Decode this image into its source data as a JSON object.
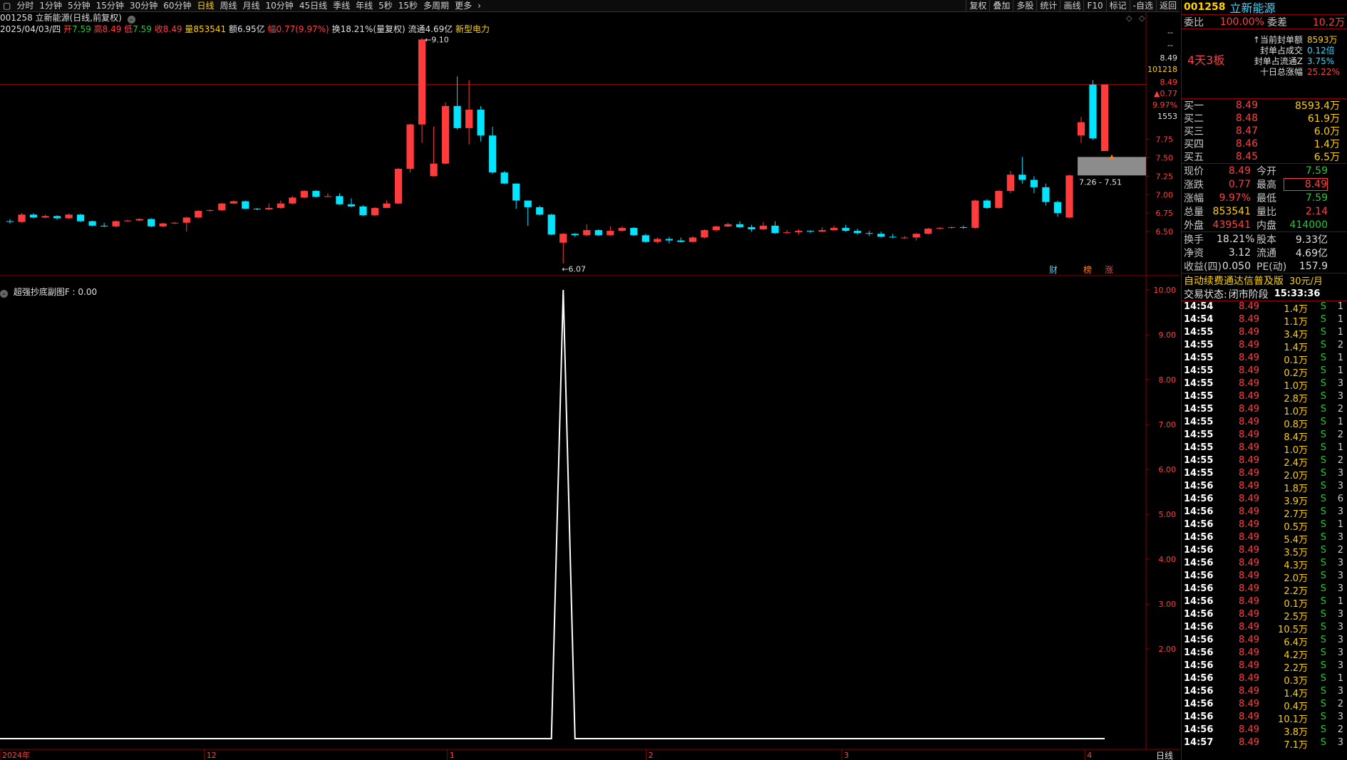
{
  "toolbar": {
    "periods": [
      "分时",
      "1分钟",
      "5分钟",
      "15分钟",
      "30分钟",
      "60分钟",
      "日线",
      "周线",
      "月线",
      "10分钟",
      "45日线",
      "季线",
      "年线",
      "5秒",
      "15秒",
      "多周期",
      "更多"
    ],
    "active": "日线",
    "right": [
      "复权",
      "叠加",
      "多股",
      "统计",
      "画线",
      "F10",
      "标记",
      "-自选",
      "返回"
    ]
  },
  "header": {
    "title": "001258 立新能源(日线,前复权)",
    "date": "2025/04/03/四",
    "open_label": "开",
    "open": "7.59",
    "high_label": "高",
    "high": "8.49",
    "low_label": "低",
    "low": "7.59",
    "close_label": "收",
    "close": "8.49",
    "vol_label": "量",
    "vol": "853541",
    "amount": "额6.95亿",
    "change_label": "幅",
    "change": "0.77(9.97%)",
    "turnover": "换18.21%(量复权) 流通4.69亿",
    "sector": "新型电力"
  },
  "annotations": {
    "high_mark": "9.10",
    "low_mark": "6.07",
    "range_box": "7.26 - 7.51",
    "badges": [
      "财",
      "榜",
      "涨"
    ]
  },
  "price_axis": {
    "top_labels": [
      "--",
      "--"
    ],
    "labels": [
      {
        "t": "8.49",
        "c": "#e0e0e0"
      },
      {
        "t": "101218",
        "c": "#ffd200"
      },
      {
        "t": "8.49",
        "c": "#ff4040"
      },
      {
        "t": "▲0.77",
        "c": "#ff4040"
      },
      {
        "t": "9.97%",
        "c": "#ff4040"
      },
      {
        "t": "1553",
        "c": "#e0e0e0"
      }
    ],
    "ticks": [
      "7.75",
      "7.50",
      "7.25",
      "7.00",
      "6.75",
      "6.50"
    ]
  },
  "indicator": {
    "title": "超强抄底副图F : 0.00",
    "ticks": [
      "10.00",
      "9.00",
      "8.00",
      "7.00",
      "6.00",
      "5.00",
      "4.00",
      "3.00",
      "2.00"
    ]
  },
  "x_axis": {
    "labels": [
      "2024年",
      "12",
      "1",
      "2",
      "3",
      "4"
    ],
    "period": "日线"
  },
  "panel": {
    "code": "001258",
    "name": "立新能源",
    "weibi_label": "委比",
    "weibi": "100.00%",
    "weicha_label": "委差",
    "weicha": "10.2万",
    "boards": "4天3板",
    "seal_info": [
      {
        "label": "当前封单额",
        "value": "8593万",
        "prefix": "↑"
      },
      {
        "label": "封单占成交",
        "value": "0.12倍",
        "prefix": ""
      },
      {
        "label": "封单占流通Z",
        "value": "3.75%",
        "prefix": ""
      },
      {
        "label": "十日总涨幅",
        "value": "25.22%",
        "prefix": ""
      }
    ],
    "bids": [
      {
        "label": "买一",
        "price": "8.49",
        "vol": "8593.4万"
      },
      {
        "label": "买二",
        "price": "8.48",
        "vol": "61.9万"
      },
      {
        "label": "买三",
        "price": "8.47",
        "vol": "6.0万"
      },
      {
        "label": "买四",
        "price": "8.46",
        "vol": "1.4万"
      },
      {
        "label": "买五",
        "price": "8.45",
        "vol": "6.5万"
      }
    ],
    "stats": [
      {
        "l1": "现价",
        "v1": "8.49",
        "c1": "red",
        "l2": "今开",
        "v2": "7.59",
        "c2": "green"
      },
      {
        "l1": "涨跌",
        "v1": "0.77",
        "c1": "red",
        "l2": "最高",
        "v2": "8.49",
        "c2": "red"
      },
      {
        "l1": "涨幅",
        "v1": "9.97%",
        "c1": "red",
        "l2": "最低",
        "v2": "7.59",
        "c2": "green"
      },
      {
        "l1": "总量",
        "v1": "853541",
        "c1": "yellow",
        "l2": "量比",
        "v2": "2.14",
        "c2": "red"
      },
      {
        "l1": "外盘",
        "v1": "439541",
        "c1": "red",
        "l2": "内盘",
        "v2": "414000",
        "c2": "green"
      }
    ],
    "stats2": [
      {
        "l1": "换手",
        "v1": "18.21%",
        "l2": "股本",
        "v2": "9.33亿"
      },
      {
        "l1": "净资",
        "v1": "3.12",
        "l2": "流通",
        "v2": "4.69亿"
      },
      {
        "l1": "收益(四)",
        "v1": "0.050",
        "l2": "PE(动)",
        "v2": "157.9"
      }
    ],
    "promo": "自动续费通达信普及版",
    "promo_price": "30元/月",
    "trade_status_label": "交易状态:",
    "trade_status": "闭市阶段",
    "trade_time": "15:33:36",
    "ticks": [
      [
        "14:54",
        "8.49",
        "1.4万",
        "S",
        "1"
      ],
      [
        "14:54",
        "8.49",
        "1.1万",
        "S",
        "1"
      ],
      [
        "14:55",
        "8.49",
        "3.4万",
        "S",
        "1"
      ],
      [
        "14:55",
        "8.49",
        "1.4万",
        "S",
        "2"
      ],
      [
        "14:55",
        "8.49",
        "0.1万",
        "S",
        "1"
      ],
      [
        "14:55",
        "8.49",
        "0.2万",
        "S",
        "1"
      ],
      [
        "14:55",
        "8.49",
        "1.0万",
        "S",
        "3"
      ],
      [
        "14:55",
        "8.49",
        "2.8万",
        "S",
        "3"
      ],
      [
        "14:55",
        "8.49",
        "1.0万",
        "S",
        "2"
      ],
      [
        "14:55",
        "8.49",
        "0.8万",
        "S",
        "1"
      ],
      [
        "14:55",
        "8.49",
        "8.4万",
        "S",
        "2"
      ],
      [
        "14:55",
        "8.49",
        "1.0万",
        "S",
        "1"
      ],
      [
        "14:55",
        "8.49",
        "2.4万",
        "S",
        "2"
      ],
      [
        "14:55",
        "8.49",
        "2.0万",
        "S",
        "3"
      ],
      [
        "14:56",
        "8.49",
        "1.8万",
        "S",
        "3"
      ],
      [
        "14:56",
        "8.49",
        "3.9万",
        "S",
        "6"
      ],
      [
        "14:56",
        "8.49",
        "2.7万",
        "S",
        "3"
      ],
      [
        "14:56",
        "8.49",
        "0.5万",
        "S",
        "1"
      ],
      [
        "14:56",
        "8.49",
        "5.4万",
        "S",
        "3"
      ],
      [
        "14:56",
        "8.49",
        "3.5万",
        "S",
        "2"
      ],
      [
        "14:56",
        "8.49",
        "4.3万",
        "S",
        "3"
      ],
      [
        "14:56",
        "8.49",
        "2.0万",
        "S",
        "3"
      ],
      [
        "14:56",
        "8.49",
        "2.2万",
        "S",
        "3"
      ],
      [
        "14:56",
        "8.49",
        "0.1万",
        "S",
        "1"
      ],
      [
        "14:56",
        "8.49",
        "2.5万",
        "S",
        "3"
      ],
      [
        "14:56",
        "8.49",
        "10.5万",
        "S",
        "3"
      ],
      [
        "14:56",
        "8.49",
        "6.4万",
        "S",
        "3"
      ],
      [
        "14:56",
        "8.49",
        "4.2万",
        "S",
        "3"
      ],
      [
        "14:56",
        "8.49",
        "2.2万",
        "S",
        "3"
      ],
      [
        "14:56",
        "8.49",
        "0.3万",
        "S",
        "1"
      ],
      [
        "14:56",
        "8.49",
        "1.4万",
        "S",
        "3"
      ],
      [
        "14:56",
        "8.49",
        "0.4万",
        "S",
        "2"
      ],
      [
        "14:56",
        "8.49",
        "10.1万",
        "S",
        "3"
      ],
      [
        "14:56",
        "8.49",
        "3.8万",
        "S",
        "2"
      ],
      [
        "14:57",
        "8.49",
        "7.1万",
        "S",
        "3"
      ]
    ]
  },
  "chart_data": {
    "type": "candlestick",
    "colors": {
      "up": "#ff3b3b",
      "down": "#00e4ff"
    },
    "candles": [
      [
        6.64,
        6.63,
        6.67,
        6.61
      ],
      [
        6.63,
        6.73,
        6.75,
        6.62
      ],
      [
        6.73,
        6.69,
        6.75,
        6.68
      ],
      [
        6.69,
        6.71,
        6.73,
        6.68
      ],
      [
        6.71,
        6.68,
        6.72,
        6.66
      ],
      [
        6.68,
        6.73,
        6.74,
        6.67
      ],
      [
        6.73,
        6.64,
        6.74,
        6.63
      ],
      [
        6.64,
        6.58,
        6.65,
        6.57
      ],
      [
        6.58,
        6.57,
        6.62,
        6.56
      ],
      [
        6.57,
        6.64,
        6.65,
        6.56
      ],
      [
        6.64,
        6.65,
        6.66,
        6.63
      ],
      [
        6.65,
        6.67,
        6.68,
        6.64
      ],
      [
        6.67,
        6.57,
        6.68,
        6.56
      ],
      [
        6.57,
        6.61,
        6.62,
        6.56
      ],
      [
        6.61,
        6.62,
        6.63,
        6.6
      ],
      [
        6.62,
        6.69,
        6.7,
        6.5
      ],
      [
        6.69,
        6.78,
        6.79,
        6.68
      ],
      [
        6.78,
        6.79,
        6.8,
        6.77
      ],
      [
        6.79,
        6.88,
        6.89,
        6.78
      ],
      [
        6.88,
        6.91,
        6.92,
        6.87
      ],
      [
        6.91,
        6.81,
        6.92,
        6.8
      ],
      [
        6.81,
        6.8,
        6.82,
        6.79
      ],
      [
        6.8,
        6.82,
        6.88,
        6.79
      ],
      [
        6.82,
        6.88,
        6.92,
        6.81
      ],
      [
        6.88,
        6.96,
        6.98,
        6.87
      ],
      [
        6.96,
        7.05,
        7.06,
        6.95
      ],
      [
        7.05,
        6.97,
        7.06,
        6.96
      ],
      [
        6.97,
        6.98,
        7.02,
        6.97
      ],
      [
        6.98,
        6.87,
        7.02,
        6.86
      ],
      [
        6.87,
        6.84,
        6.95,
        6.83
      ],
      [
        6.84,
        6.72,
        6.86,
        6.71
      ],
      [
        6.72,
        6.82,
        6.83,
        6.71
      ],
      [
        6.82,
        6.88,
        6.92,
        6.87
      ],
      [
        6.88,
        7.35,
        7.36,
        6.87
      ],
      [
        7.35,
        7.95,
        7.96,
        7.3
      ],
      [
        7.95,
        9.1,
        9.12,
        7.7
      ],
      [
        7.25,
        7.42,
        7.92,
        7.24
      ],
      [
        7.42,
        8.2,
        8.25,
        7.41
      ],
      [
        8.2,
        7.9,
        8.6,
        7.88
      ],
      [
        7.9,
        8.15,
        8.55,
        7.68
      ],
      [
        8.15,
        7.8,
        8.2,
        7.72
      ],
      [
        7.8,
        7.3,
        7.92,
        7.28
      ],
      [
        7.3,
        7.15,
        7.32,
        7.14
      ],
      [
        7.15,
        6.92,
        7.15,
        6.81
      ],
      [
        6.92,
        6.83,
        6.92,
        6.58
      ],
      [
        6.83,
        6.73,
        6.85,
        6.72
      ],
      [
        6.73,
        6.46,
        6.74,
        6.45
      ],
      [
        6.35,
        6.47,
        6.48,
        6.07
      ],
      [
        6.47,
        6.45,
        6.48,
        6.43
      ],
      [
        6.45,
        6.52,
        6.6,
        6.44
      ],
      [
        6.52,
        6.45,
        6.53,
        6.44
      ],
      [
        6.45,
        6.51,
        6.57,
        6.44
      ],
      [
        6.51,
        6.55,
        6.57,
        6.5
      ],
      [
        6.55,
        6.45,
        6.56,
        6.44
      ],
      [
        6.45,
        6.36,
        6.47,
        6.35
      ],
      [
        6.36,
        6.4,
        6.42,
        6.34
      ],
      [
        6.4,
        6.38,
        6.43,
        6.34
      ],
      [
        6.38,
        6.36,
        6.42,
        6.35
      ],
      [
        6.36,
        6.42,
        6.44,
        6.35
      ],
      [
        6.42,
        6.52,
        6.53,
        6.41
      ],
      [
        6.52,
        6.57,
        6.58,
        6.5
      ],
      [
        6.57,
        6.6,
        6.62,
        6.56
      ],
      [
        6.6,
        6.56,
        6.64,
        6.55
      ],
      [
        6.56,
        6.53,
        6.59,
        6.5
      ],
      [
        6.53,
        6.58,
        6.63,
        6.52
      ],
      [
        6.58,
        6.48,
        6.64,
        6.47
      ],
      [
        6.48,
        6.49,
        6.52,
        6.47
      ],
      [
        6.49,
        6.51,
        6.53,
        6.46
      ],
      [
        6.51,
        6.5,
        6.52,
        6.48
      ],
      [
        6.5,
        6.52,
        6.56,
        6.49
      ],
      [
        6.52,
        6.55,
        6.58,
        6.51
      ],
      [
        6.55,
        6.51,
        6.59,
        6.5
      ],
      [
        6.51,
        6.48,
        6.54,
        6.46
      ],
      [
        6.48,
        6.47,
        6.51,
        6.44
      ],
      [
        6.47,
        6.43,
        6.5,
        6.42
      ],
      [
        6.43,
        6.42,
        6.47,
        6.41
      ],
      [
        6.42,
        6.42,
        6.44,
        6.4
      ],
      [
        6.42,
        6.47,
        6.48,
        6.38
      ],
      [
        6.47,
        6.54,
        6.55,
        6.46
      ],
      [
        6.54,
        6.55,
        6.56,
        6.53
      ],
      [
        6.55,
        6.56,
        6.57,
        6.54
      ],
      [
        6.56,
        6.55,
        6.58,
        6.54
      ],
      [
        6.55,
        6.92,
        6.93,
        6.54
      ],
      [
        6.92,
        6.82,
        6.94,
        6.81
      ],
      [
        6.82,
        7.05,
        7.06,
        6.81
      ],
      [
        7.05,
        7.27,
        7.32,
        7.02
      ],
      [
        7.27,
        7.2,
        7.51,
        7.15
      ],
      [
        7.2,
        7.1,
        7.25,
        7.02
      ],
      [
        7.1,
        6.9,
        7.15,
        6.85
      ],
      [
        6.9,
        6.75,
        6.92,
        6.7
      ],
      [
        6.69,
        7.26,
        7.27,
        6.68
      ],
      [
        7.8,
        7.98,
        8.05,
        7.7
      ],
      [
        8.49,
        7.76,
        8.55,
        7.74
      ],
      [
        7.59,
        8.49,
        8.49,
        7.59
      ]
    ],
    "ylim": [
      6.0,
      9.2
    ],
    "indicator_series": {
      "name": "超强抄底副图F",
      "values_at_candle_index": {
        "47": 10.0
      },
      "default": 0.0,
      "ylim": [
        0,
        10
      ]
    }
  }
}
